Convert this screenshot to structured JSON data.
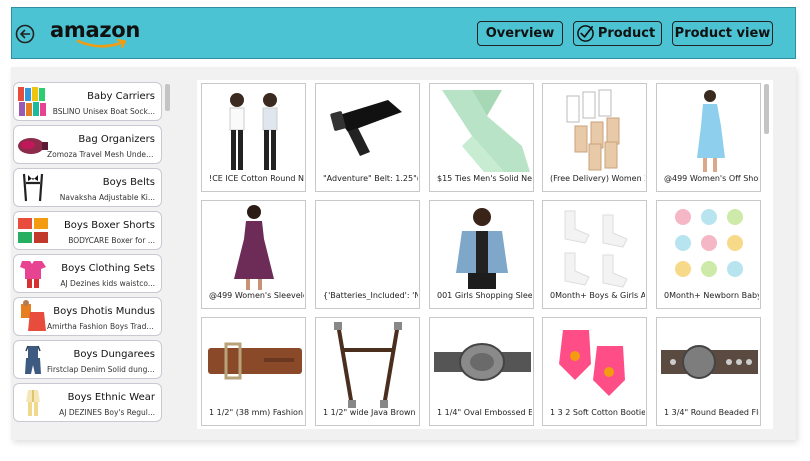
{
  "header": {
    "logo_text": "amazon",
    "nav": {
      "overview": "Overview",
      "product": "Product",
      "product_view": "Product view"
    },
    "accent_color": "#4bc3d2"
  },
  "sidebar": {
    "items": [
      {
        "title": "Baby Carriers",
        "subtitle": "BSLINO Unisex Boat Sock...",
        "icon": "socks-thumbnail"
      },
      {
        "title": "Bag Organizers",
        "subtitle": "Zomoza Travel Mesh Underwe...",
        "icon": "bag-thumbnail"
      },
      {
        "title": "Boys Belts",
        "subtitle": "Navaksha Adjustable Ki...",
        "icon": "suspenders-thumbnail"
      },
      {
        "title": "Boys Boxer Shorts",
        "subtitle": "BODYCARE Boxer for ...",
        "icon": "boxers-thumbnail"
      },
      {
        "title": "Boys Clothing Sets",
        "subtitle": "AJ Dezines kids waistco...",
        "icon": "clothing-set-thumbnail"
      },
      {
        "title": "Boys Dhotis Mundus",
        "subtitle": "Amirtha Fashion Boys Traditi...",
        "icon": "dhoti-thumbnail"
      },
      {
        "title": "Boys Dungarees",
        "subtitle": "Firstclap Denim Solid dungre...",
        "icon": "dungarees-thumbnail"
      },
      {
        "title": "Boys Ethnic Wear",
        "subtitle": "AJ DEZINES Boy's Regul...",
        "icon": "ethnic-wear-thumbnail"
      }
    ]
  },
  "products": [
    {
      "label": "!CE ICE Cotton Round Ne",
      "image": "two-girls"
    },
    {
      "label": "\"Adventure\" Belt: 1.25\"(3",
      "image": "black-strap"
    },
    {
      "label": "$15 Ties Men's Solid Nec",
      "image": "green-tie"
    },
    {
      "label": "(Free Delivery) Women 2",
      "image": "bra-extenders"
    },
    {
      "label": "@499 Women's Off Shou",
      "image": "blue-dress"
    },
    {
      "label": "@499 Women's Sleevele",
      "image": "purple-dress"
    },
    {
      "label": "{'Batteries_Included': 'No",
      "image": "blank"
    },
    {
      "label": "001 Girls Shopping Sleev",
      "image": "denim-jacket"
    },
    {
      "label": "0Month+ Boys & Girls An",
      "image": "white-socks"
    },
    {
      "label": "0Month+ Newborn Baby",
      "image": "baby-caps"
    },
    {
      "label": "1 1/2\" (38 mm) Fashion C",
      "image": "brown-belt"
    },
    {
      "label": "1 1/2\" wide Java Brown I",
      "image": "suspenders"
    },
    {
      "label": "1 1/4\" Oval Embossed Er",
      "image": "oval-buckle-belt"
    },
    {
      "label": "1 3 2 Soft Cotton Booties",
      "image": "pink-booties"
    },
    {
      "label": "1 3/4\" Round Beaded Flo",
      "image": "beaded-belt"
    }
  ]
}
